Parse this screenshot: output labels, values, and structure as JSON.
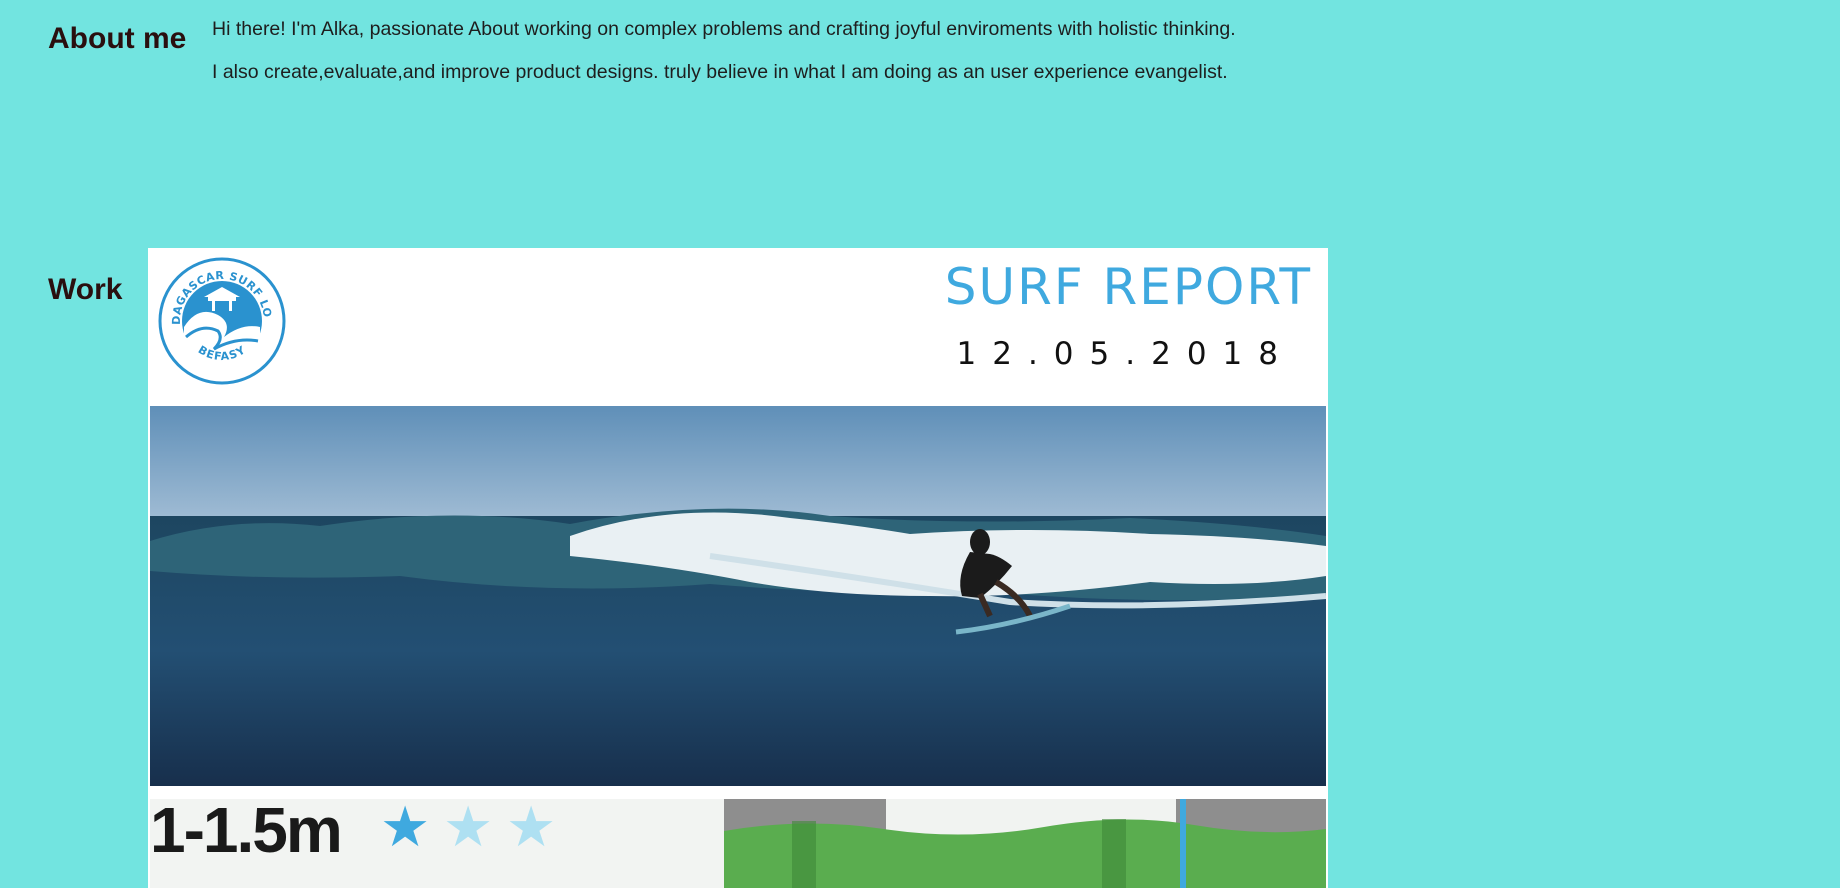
{
  "about": {
    "heading": "About me",
    "line1": "Hi there! I'm Alka, passionate About working on complex problems and crafting joyful enviroments with holistic thinking.",
    "line2": "I also create,evaluate,and improve product designs. truly believe in what I am doing as an user experience evangelist."
  },
  "work": {
    "heading": "Work",
    "card": {
      "logo_text": "MADAGASCAR SURF LODGE",
      "logo_subtext": "BEFASY",
      "title": "SURF REPORT",
      "date": "12.05.2018",
      "wave_height": "1-1.5m",
      "rating": 1,
      "rating_max": 3,
      "colors": {
        "accent": "#3fa9df",
        "star_off": "#aee0f2",
        "background": "#72e4e0"
      }
    }
  }
}
